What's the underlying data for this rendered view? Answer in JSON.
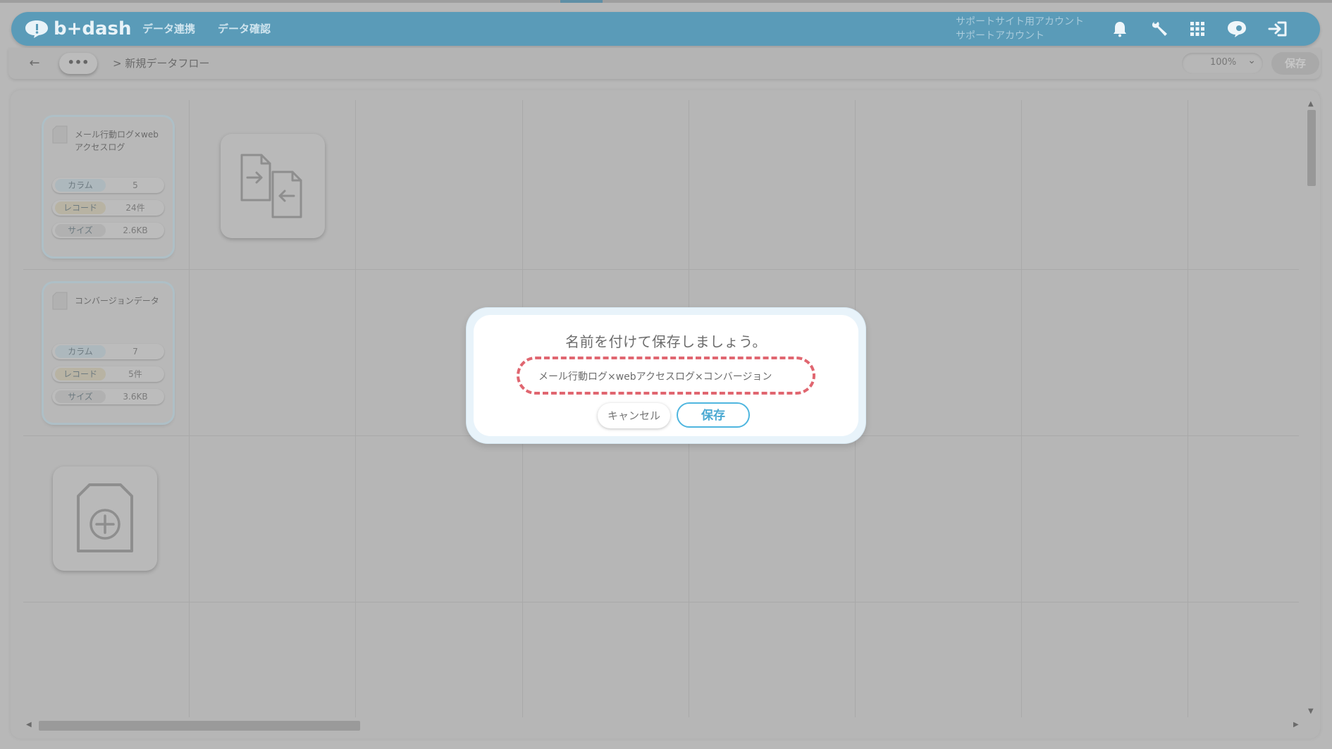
{
  "app": {
    "logo_text": "b+dash",
    "nav": [
      "データ連携",
      "データ確認"
    ],
    "account_line1": "サポートサイト用アカウント",
    "account_line2": "サポートアカウント",
    "icons": [
      "bell-icon",
      "wrench-icon",
      "grid-icon",
      "chat-icon",
      "logout-icon"
    ],
    "accent": "#5a9bb8"
  },
  "toolbar": {
    "back_glyph": "←",
    "more_label": "•••",
    "breadcrumb": "> 新規データフロー",
    "zoom": "100%",
    "zoom_chevron": "⌄",
    "save_label": "保存"
  },
  "cards": [
    {
      "title": "メール行動ログ×webアクセスログ",
      "stats": [
        {
          "label": "カラム",
          "value": "5"
        },
        {
          "label": "レコード",
          "value": "24件"
        },
        {
          "label": "サイズ",
          "value": "2.6KB"
        }
      ]
    },
    {
      "title": "コンバージョンデータ",
      "stats": [
        {
          "label": "カラム",
          "value": "7"
        },
        {
          "label": "レコード",
          "value": "5件"
        },
        {
          "label": "サイズ",
          "value": "3.6KB"
        }
      ]
    }
  ],
  "dialog": {
    "title": "名前を付けて保存しましょう。",
    "name_value": "メール行動ログ×webアクセスログ×コンバージョン",
    "cancel_label": "キャンセル",
    "save_label": "保存",
    "highlight_color": "#e06670"
  }
}
